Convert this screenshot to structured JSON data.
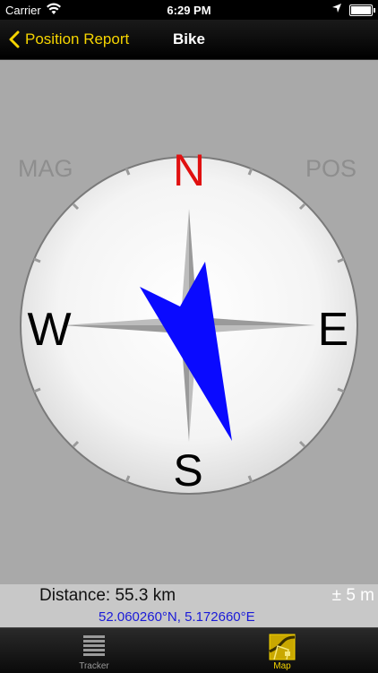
{
  "status_bar": {
    "carrier": "Carrier",
    "time": "6:29 PM",
    "wifi_icon": "wifi-icon",
    "location_icon": "location-arrow-icon",
    "battery_icon": "battery-icon"
  },
  "nav": {
    "back_label": "Position Report",
    "title": "Bike",
    "accent_color": "#f5d400"
  },
  "compass": {
    "mode_left": "MAG",
    "mode_right": "POS",
    "north": "N",
    "south": "S",
    "east": "E",
    "west": "W",
    "north_color": "#e01010",
    "needle_color": "#0a0aff"
  },
  "info": {
    "distance": "Distance: 55.3 km",
    "accuracy": "± 5 m",
    "coordinates": "52.060260°N, 5.172660°E"
  },
  "tabs": [
    {
      "label": "Tracker",
      "icon": "list-icon",
      "selected": false
    },
    {
      "label": "Map",
      "icon": "map-icon",
      "selected": true
    }
  ]
}
